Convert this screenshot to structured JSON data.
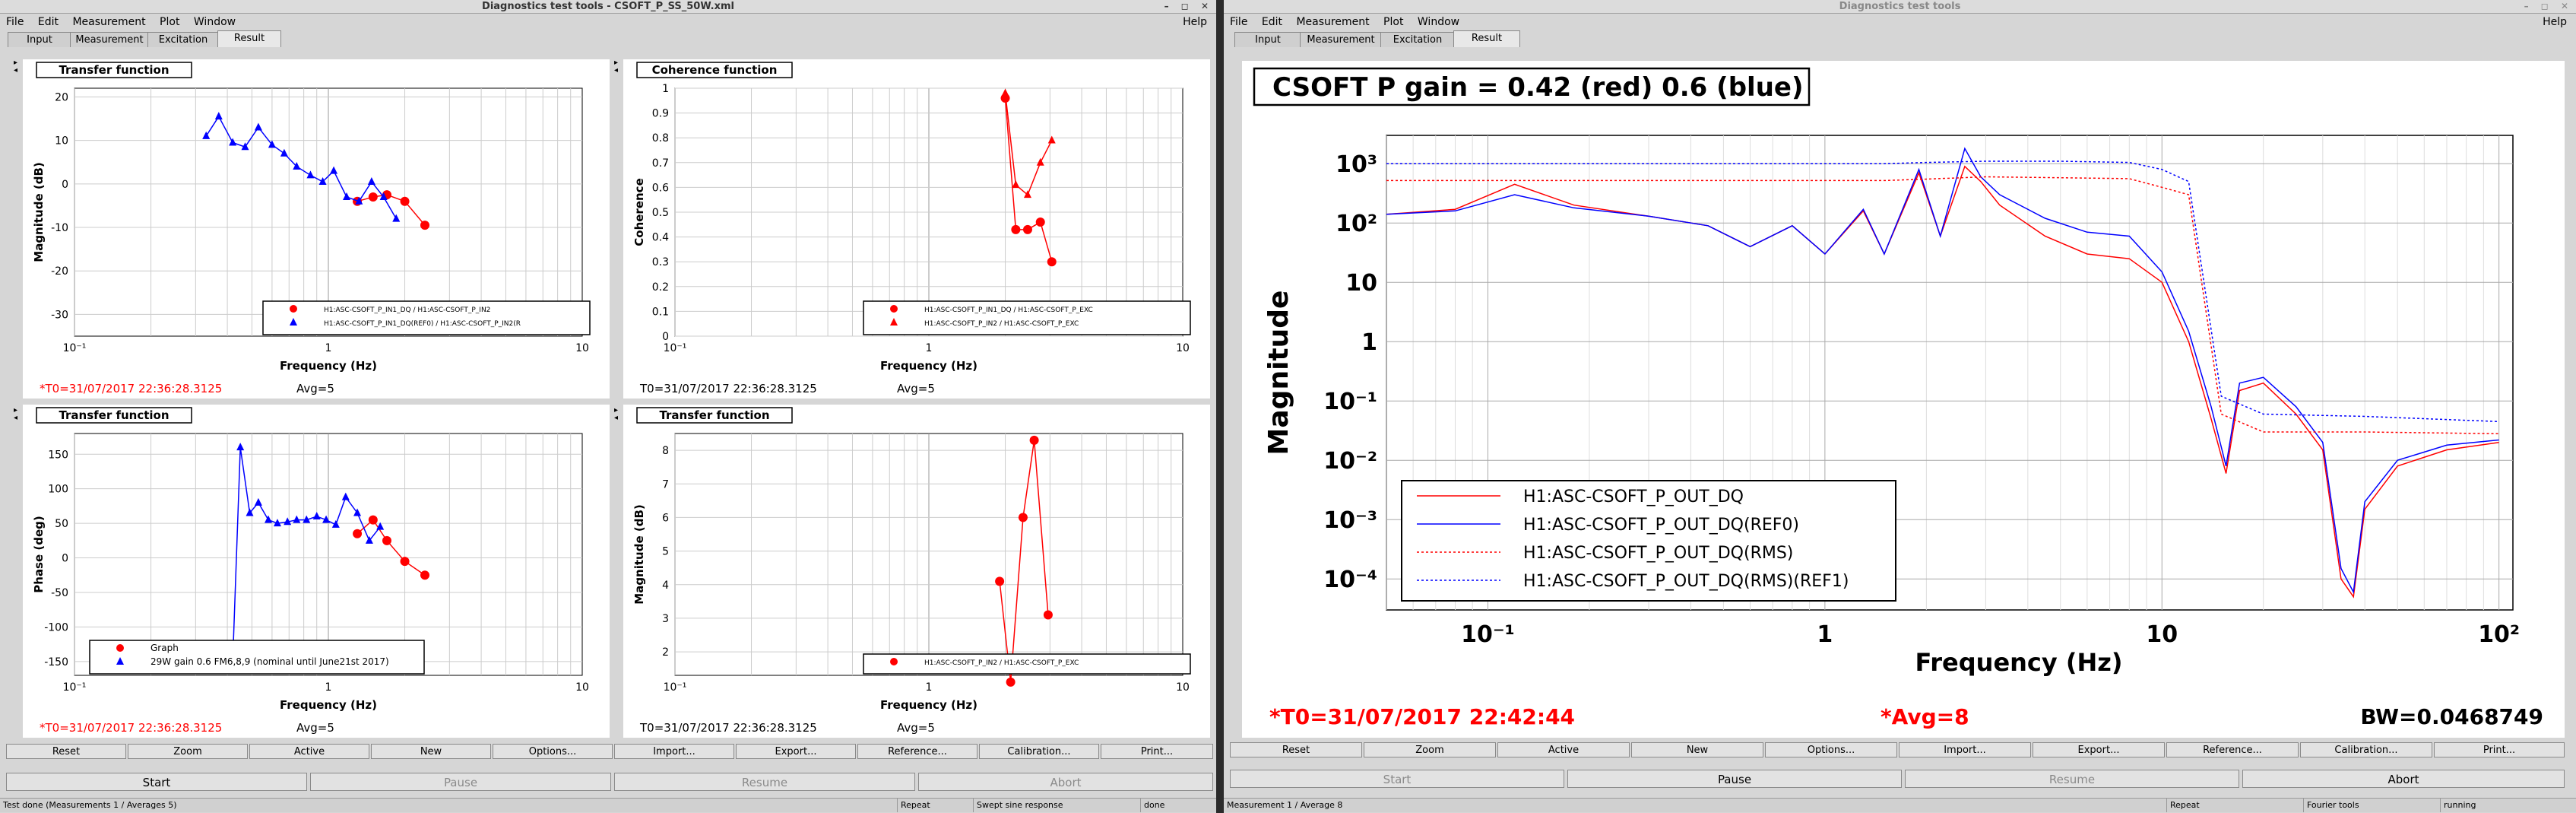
{
  "left": {
    "title": "Diagnostics test tools - CSOFT_P_SS_50W.xml",
    "controls": "– ◻ ✕",
    "menu": [
      "File",
      "Edit",
      "Measurement",
      "Plot",
      "Window"
    ],
    "help": "Help",
    "tabs": [
      "Input",
      "Measurement",
      "Excitation",
      "Result"
    ],
    "panes": [
      {
        "title": "Transfer function",
        "ylabel": "Magnitude (dB)",
        "xlabel": "Frequency (Hz)",
        "yticks": [
          "20",
          "10",
          "0",
          "-10",
          "-20",
          "-30"
        ],
        "xticks": [
          "10⁻¹",
          "1",
          "10"
        ],
        "legend": [
          "H1:ASC-CSOFT_P_IN1_DQ / H1:ASC-CSOFT_P_IN2",
          "H1:ASC-CSOFT_P_IN1_DQ(REF0) / H1:ASC-CSOFT_P_IN2(R"
        ],
        "t0": "*T0=31/07/2017 22:36:28.3125",
        "avg": "Avg=5",
        "t0_red": true
      },
      {
        "title": "Coherence function",
        "ylabel": "Coherence",
        "xlabel": "Frequency (Hz)",
        "yticks": [
          "1",
          "0.9",
          "0.8",
          "0.7",
          "0.6",
          "0.5",
          "0.4",
          "0.3",
          "0.2",
          "0.1",
          "0"
        ],
        "xticks": [
          "10⁻¹",
          "1",
          "10"
        ],
        "legend": [
          "H1:ASC-CSOFT_P_IN1_DQ / H1:ASC-CSOFT_P_EXC",
          "H1:ASC-CSOFT_P_IN2 / H1:ASC-CSOFT_P_EXC"
        ],
        "t0": "T0=31/07/2017 22:36:28.3125",
        "avg": "Avg=5",
        "t0_red": false
      },
      {
        "title": "Transfer function",
        "ylabel": "Phase (deg)",
        "xlabel": "Frequency (Hz)",
        "yticks": [
          "150",
          "100",
          "50",
          "0",
          "-50",
          "-100",
          "-150"
        ],
        "xticks": [
          "10⁻¹",
          "1",
          "10"
        ],
        "legend": [
          "Graph",
          "29W gain 0.6 FM6,8,9 (nominal until June21st 2017)"
        ],
        "t0": "*T0=31/07/2017 22:36:28.3125",
        "avg": "Avg=5",
        "t0_red": true
      },
      {
        "title": "Transfer function",
        "ylabel": "Magnitude (dB)",
        "xlabel": "Frequency (Hz)",
        "yticks": [
          "8",
          "7",
          "6",
          "5",
          "4",
          "3",
          "2"
        ],
        "xticks": [
          "10⁻¹",
          "1",
          "10"
        ],
        "legend": [
          "H1:ASC-CSOFT_P_IN2 / H1:ASC-CSOFT_P_EXC"
        ],
        "t0": "T0=31/07/2017 22:36:28.3125",
        "avg": "Avg=5",
        "t0_red": false
      }
    ],
    "buttons": [
      "Reset",
      "Zoom",
      "Active",
      "New",
      "Options...",
      "Import...",
      "Export...",
      "Reference...",
      "Calibration...",
      "Print..."
    ],
    "actions": [
      "Start",
      "Pause",
      "Resume",
      "Abort"
    ],
    "status": [
      "Test done (Measurements 1 / Averages 5)",
      "Repeat",
      "Swept sine response",
      "done"
    ]
  },
  "right": {
    "title": "Diagnostics test tools",
    "controls": "– ◻ ✕",
    "menu": [
      "File",
      "Edit",
      "Measurement",
      "Plot",
      "Window"
    ],
    "help": "Help",
    "tabs": [
      "Input",
      "Measurement",
      "Excitation",
      "Result"
    ],
    "plot_title": "CSOFT P gain = 0.42 (red) 0.6 (blue)",
    "ylabel": "Magnitude",
    "xlabel": "Frequency (Hz)",
    "yticks": [
      "10³",
      "10²",
      "10",
      "1",
      "10⁻¹",
      "10⁻²",
      "10⁻³",
      "10⁻⁴"
    ],
    "xticks": [
      "10⁻¹",
      "1",
      "10",
      "10²"
    ],
    "legend": [
      "H1:ASC-CSOFT_P_OUT_DQ",
      "H1:ASC-CSOFT_P_OUT_DQ(REF0)",
      "H1:ASC-CSOFT_P_OUT_DQ(RMS)",
      "H1:ASC-CSOFT_P_OUT_DQ(RMS)(REF1)"
    ],
    "t0": "*T0=31/07/2017 22:42:44",
    "avg": "*Avg=8",
    "bw": "BW=0.0468749",
    "buttons": [
      "Reset",
      "Zoom",
      "Active",
      "New",
      "Options...",
      "Import...",
      "Export...",
      "Reference...",
      "Calibration...",
      "Print..."
    ],
    "actions": [
      "Start",
      "Pause",
      "Resume",
      "Abort"
    ],
    "status": [
      "Measurement 1 / Average 8",
      "Repeat",
      "Fourier tools",
      "running"
    ]
  },
  "colors": {
    "red": "#ff0000",
    "blue": "#0000ff",
    "time_red": "#ff0000"
  },
  "chart_data": [
    {
      "type": "scatter",
      "title": "Transfer function",
      "xscale": "log",
      "xlim": [
        0.1,
        10
      ],
      "ylim": [
        -35,
        22
      ],
      "xlabel": "Frequency (Hz)",
      "ylabel": "Magnitude (dB)",
      "series": [
        {
          "name": "H1:ASC-CSOFT_P_IN1_DQ / H1:ASC-CSOFT_P_IN2",
          "color": "#ff0000",
          "marker": "circle",
          "x": [
            1.3,
            1.5,
            1.7,
            2.0,
            2.4
          ],
          "y": [
            -4,
            -3,
            -2.5,
            -4,
            -9.5
          ]
        },
        {
          "name": "H1:ASC-CSOFT_P_IN1_DQ(REF0) / H1:ASC-CSOFT_P_IN2(R",
          "color": "#0000ff",
          "marker": "triangle",
          "x": [
            0.33,
            0.37,
            0.42,
            0.47,
            0.53,
            0.6,
            0.67,
            0.75,
            0.85,
            0.95,
            1.05,
            1.18,
            1.32,
            1.48,
            1.65,
            1.85
          ],
          "y": [
            11,
            15.5,
            9.5,
            8.5,
            13,
            9,
            7,
            4,
            2,
            0.5,
            3,
            -3,
            -4,
            0.5,
            -3,
            -8
          ]
        }
      ]
    },
    {
      "type": "scatter",
      "title": "Coherence function",
      "xscale": "log",
      "xlim": [
        0.1,
        10
      ],
      "ylim": [
        0,
        1
      ],
      "xlabel": "Frequency (Hz)",
      "ylabel": "Coherence",
      "series": [
        {
          "name": "H1:ASC-CSOFT_P_IN1_DQ / H1:ASC-CSOFT_P_EXC",
          "color": "#ff0000",
          "marker": "circle",
          "x": [
            2.0,
            2.2,
            2.45,
            2.75,
            3.05
          ],
          "y": [
            0.96,
            0.43,
            0.43,
            0.46,
            0.3
          ]
        },
        {
          "name": "H1:ASC-CSOFT_P_IN2 / H1:ASC-CSOFT_P_EXC",
          "color": "#ff0000",
          "marker": "triangle",
          "x": [
            2.0,
            2.2,
            2.45,
            2.75,
            3.05
          ],
          "y": [
            0.98,
            0.61,
            0.57,
            0.7,
            0.79
          ]
        }
      ]
    },
    {
      "type": "scatter",
      "title": "Transfer function",
      "xscale": "log",
      "xlim": [
        0.1,
        10
      ],
      "ylim": [
        -170,
        180
      ],
      "xlabel": "Frequency (Hz)",
      "ylabel": "Phase (deg)",
      "series": [
        {
          "name": "Graph",
          "color": "#ff0000",
          "marker": "circle",
          "x": [
            1.3,
            1.5,
            1.7,
            2.0,
            2.4
          ],
          "y": [
            35,
            55,
            25,
            -5,
            -25
          ]
        },
        {
          "name": "29W gain 0.6 FM6,8,9 (nominal until June21st 2017)",
          "color": "#0000ff",
          "marker": "triangle",
          "x": [
            0.42,
            0.45,
            0.49,
            0.53,
            0.58,
            0.63,
            0.69,
            0.75,
            0.82,
            0.9,
            0.98,
            1.07,
            1.17,
            1.3,
            1.45,
            1.6
          ],
          "y": [
            -150,
            160,
            65,
            80,
            55,
            50,
            52,
            55,
            55,
            60,
            55,
            48,
            88,
            65,
            25,
            45
          ]
        }
      ]
    },
    {
      "type": "scatter",
      "title": "Transfer function",
      "xscale": "log",
      "xlim": [
        0.1,
        10
      ],
      "ylim": [
        1.3,
        8.5
      ],
      "xlabel": "Frequency (Hz)",
      "ylabel": "Magnitude (dB)",
      "series": [
        {
          "name": "H1:ASC-CSOFT_P_IN2 / H1:ASC-CSOFT_P_EXC",
          "color": "#ff0000",
          "marker": "circle",
          "x": [
            1.9,
            2.1,
            2.35,
            2.6,
            2.95
          ],
          "y": [
            4.1,
            1.1,
            6.0,
            8.3,
            3.1
          ]
        }
      ]
    },
    {
      "type": "line",
      "title": "CSOFT P gain = 0.42 (red) 0.6 (blue)",
      "xscale": "log",
      "yscale": "log",
      "xlim": [
        0.05,
        110
      ],
      "ylim": [
        3e-05,
        3000
      ],
      "xlabel": "Frequency (Hz)",
      "ylabel": "Magnitude",
      "series": [
        {
          "name": "H1:ASC-CSOFT_P_OUT_DQ",
          "color": "#ff0000",
          "style": "solid",
          "x": [
            0.05,
            0.08,
            0.12,
            0.18,
            0.3,
            0.45,
            0.6,
            0.8,
            1.0,
            1.3,
            1.5,
            1.9,
            2.2,
            2.6,
            2.9,
            3.3,
            4.5,
            6,
            8,
            10,
            12,
            14,
            15.5,
            17,
            20,
            25,
            30,
            34,
            37,
            40,
            50,
            70,
            100
          ],
          "y": [
            140,
            170,
            450,
            200,
            130,
            90,
            40,
            90,
            30,
            160,
            30,
            700,
            60,
            900,
            500,
            200,
            60,
            30,
            25,
            10,
            1,
            0.05,
            0.006,
            0.15,
            0.2,
            0.06,
            0.015,
            0.0001,
            5e-05,
            0.0015,
            0.008,
            0.015,
            0.02
          ]
        },
        {
          "name": "H1:ASC-CSOFT_P_OUT_DQ(REF0)",
          "color": "#0000ff",
          "style": "solid",
          "x": [
            0.05,
            0.08,
            0.12,
            0.18,
            0.3,
            0.45,
            0.6,
            0.8,
            1.0,
            1.3,
            1.5,
            1.9,
            2.2,
            2.6,
            2.9,
            3.3,
            4.5,
            6,
            8,
            10,
            12,
            14,
            15.5,
            17,
            20,
            25,
            30,
            34,
            37,
            40,
            50,
            70,
            100
          ],
          "y": [
            140,
            160,
            300,
            180,
            130,
            90,
            40,
            90,
            30,
            170,
            30,
            800,
            60,
            1800,
            600,
            300,
            120,
            70,
            60,
            15,
            1.5,
            0.08,
            0.008,
            0.2,
            0.25,
            0.08,
            0.02,
            0.00015,
            6e-05,
            0.002,
            0.01,
            0.018,
            0.022
          ]
        },
        {
          "name": "H1:ASC-CSOFT_P_OUT_DQ(RMS)",
          "color": "#ff0000",
          "style": "dotted",
          "x": [
            0.05,
            1.5,
            2.0,
            3.0,
            5.0,
            8.0,
            10,
            12,
            15,
            20,
            40,
            100
          ],
          "y": [
            520,
            520,
            550,
            600,
            580,
            560,
            400,
            300,
            0.06,
            0.03,
            0.03,
            0.028
          ]
        },
        {
          "name": "H1:ASC-CSOFT_P_OUT_DQ(RMS)(REF1)",
          "color": "#0000ff",
          "style": "dotted",
          "x": [
            0.05,
            1.5,
            2.0,
            3.0,
            5.0,
            8.0,
            10,
            12,
            15,
            20,
            40,
            100
          ],
          "y": [
            1000,
            1000,
            1050,
            1100,
            1100,
            1050,
            800,
            500,
            0.12,
            0.06,
            0.055,
            0.045
          ]
        }
      ]
    }
  ]
}
